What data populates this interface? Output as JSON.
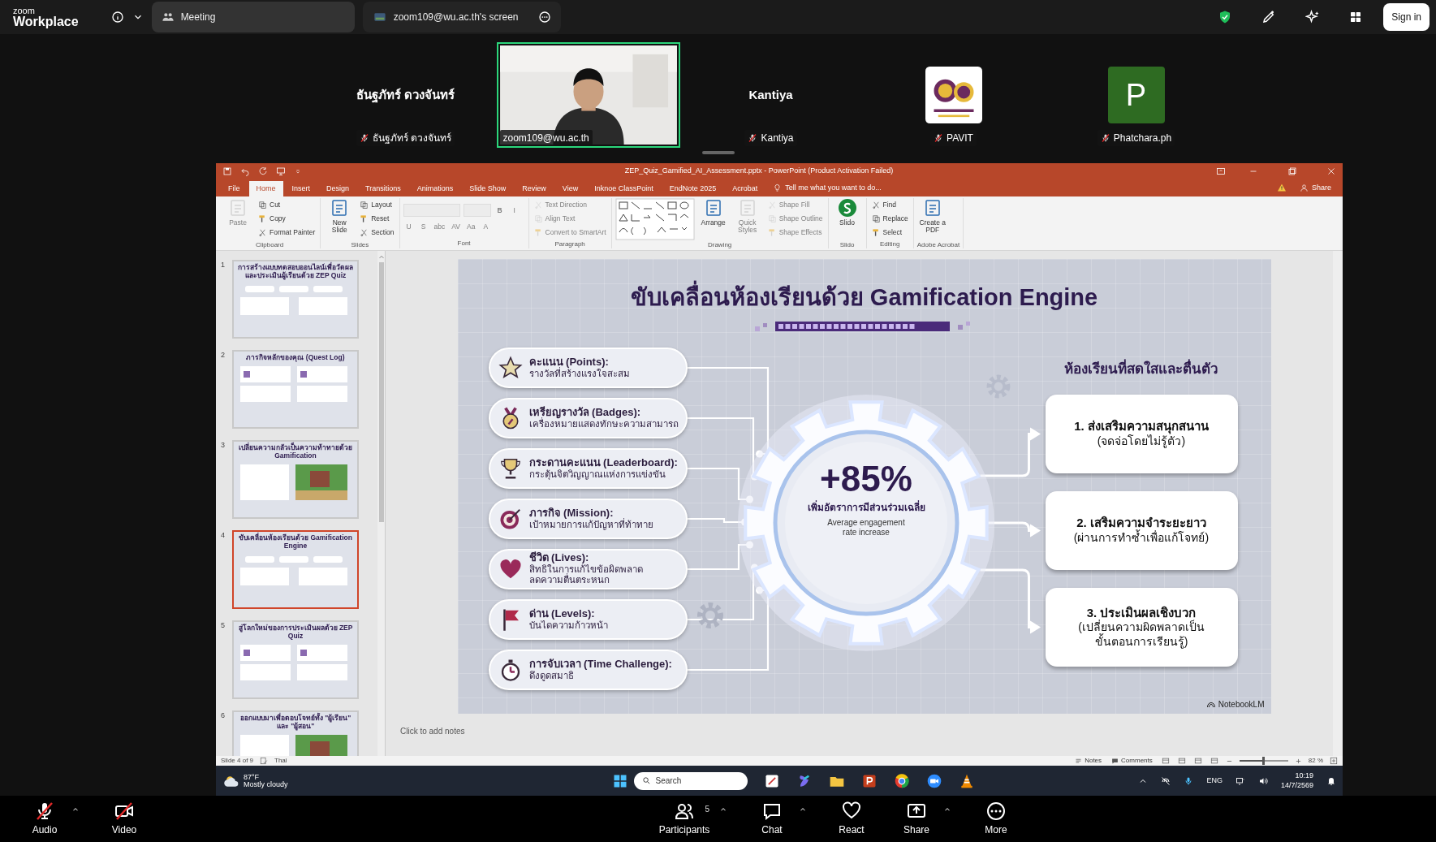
{
  "zoom_header": {
    "logo_top": "zoom",
    "logo_bottom": "Workplace",
    "tabs": [
      {
        "label": "Meeting",
        "selected": false
      },
      {
        "label": "zoom109@wu.ac.th's screen",
        "selected": true
      }
    ],
    "sign_in": "Sign in"
  },
  "participants": [
    {
      "kind": "name",
      "display_name": "ธันฐภัทร์ ดวงจันทร์",
      "label": "ธันฐภัทร์ ดวงจันทร์",
      "muted": true,
      "speaking": false
    },
    {
      "kind": "video",
      "label": "zoom109@wu.ac.th",
      "muted": false,
      "speaking": true
    },
    {
      "kind": "name",
      "display_name": "Kantiya",
      "label": "Kantiya",
      "muted": true,
      "speaking": false
    },
    {
      "kind": "logo",
      "label": "PAVIT",
      "muted": true,
      "speaking": false
    },
    {
      "kind": "initial",
      "initial": "P",
      "label": "Phatchara.ph",
      "muted": true,
      "speaking": false
    }
  ],
  "powerpoint": {
    "title": "ZEP_Quiz_Gamified_AI_Assessment.pptx - PowerPoint (Product Activation Failed)",
    "ribbon_tabs": [
      {
        "label": "File",
        "selected": false
      },
      {
        "label": "Home",
        "selected": true
      },
      {
        "label": "Insert",
        "selected": false
      },
      {
        "label": "Design",
        "selected": false
      },
      {
        "label": "Transitions",
        "selected": false
      },
      {
        "label": "Animations",
        "selected": false
      },
      {
        "label": "Slide Show",
        "selected": false
      },
      {
        "label": "Review",
        "selected": false
      },
      {
        "label": "View",
        "selected": false
      },
      {
        "label": "Inknoe ClassPoint",
        "selected": false
      },
      {
        "label": "EndNote 2025",
        "selected": false
      },
      {
        "label": "Acrobat",
        "selected": false
      }
    ],
    "tell_me": "Tell me what you want to do...",
    "share": "Share",
    "ribbon_groups": [
      {
        "label": "Clipboard",
        "items": [
          {
            "kind": "large",
            "label": "Paste",
            "disabled": true
          },
          {
            "kind": "small",
            "label": "Cut",
            "disabled": false
          },
          {
            "kind": "small",
            "label": "Copy",
            "disabled": false
          },
          {
            "kind": "small",
            "label": "Format Painter",
            "disabled": false
          }
        ]
      },
      {
        "label": "Slides",
        "items": [
          {
            "kind": "large",
            "label": "New Slide",
            "disabled": false
          },
          {
            "kind": "small",
            "label": "Layout",
            "disabled": false
          },
          {
            "kind": "small",
            "label": "Reset",
            "disabled": false
          },
          {
            "kind": "small",
            "label": "Section",
            "disabled": false
          }
        ]
      },
      {
        "label": "Font",
        "items": [
          {
            "kind": "field",
            "disabled": true
          },
          {
            "kind": "field",
            "disabled": true
          },
          {
            "kind": "glyph",
            "label": "B",
            "disabled": true
          },
          {
            "kind": "glyph",
            "label": "I",
            "disabled": true
          },
          {
            "kind": "glyph",
            "label": "U",
            "disabled": true
          },
          {
            "kind": "glyph",
            "label": "S",
            "disabled": true
          },
          {
            "kind": "glyph",
            "label": "abc",
            "disabled": true
          },
          {
            "kind": "glyph",
            "label": "AV",
            "disabled": true
          },
          {
            "kind": "glyph",
            "label": "Aa",
            "disabled": true
          },
          {
            "kind": "glyph",
            "label": "A",
            "disabled": true
          }
        ]
      },
      {
        "label": "Paragraph",
        "items": [
          {
            "kind": "small",
            "label": "Text Direction",
            "disabled": true
          },
          {
            "kind": "small",
            "label": "Align Text",
            "disabled": true
          },
          {
            "kind": "small",
            "label": "Convert to SmartArt",
            "disabled": true
          }
        ]
      },
      {
        "label": "Drawing",
        "items": [
          {
            "kind": "gallery"
          },
          {
            "kind": "large",
            "label": "Arrange",
            "disabled": false
          },
          {
            "kind": "large",
            "label": "Quick Styles",
            "disabled": true
          },
          {
            "kind": "small",
            "label": "Shape Fill",
            "disabled": true
          },
          {
            "kind": "small",
            "label": "Shape Outline",
            "disabled": true
          },
          {
            "kind": "small",
            "label": "Shape Effects",
            "disabled": true
          }
        ]
      },
      {
        "label": "Slido",
        "items": [
          {
            "kind": "large",
            "label": "Slido",
            "disabled": false
          }
        ]
      },
      {
        "label": "Editing",
        "items": [
          {
            "kind": "small",
            "label": "Find",
            "disabled": false
          },
          {
            "kind": "small",
            "label": "Replace",
            "disabled": false
          },
          {
            "kind": "small",
            "label": "Select",
            "disabled": false
          }
        ]
      },
      {
        "label": "Adobe Acrobat",
        "items": [
          {
            "kind": "large",
            "label": "Create a PDF",
            "disabled": false
          }
        ]
      }
    ],
    "thumbnails": [
      {
        "number": "1",
        "title": "การสร้างแบบทดสอบออนไลน์เพื่อวัดผลและประเมินผู้เรียนด้วย ZEP Quiz",
        "selected": false
      },
      {
        "number": "2",
        "title": "ภารกิจหลักของคุณ (Quest Log)",
        "selected": false
      },
      {
        "number": "3",
        "title": "เปลี่ยนความกลัวเป็นความท้าทายด้วย Gamification",
        "selected": false
      },
      {
        "number": "4",
        "title": "ขับเคลื่อนห้องเรียนด้วย Gamification Engine",
        "selected": true
      },
      {
        "number": "5",
        "title": "สู่โลกใหม่ของการประเมินผลด้วย ZEP Quiz",
        "selected": false
      },
      {
        "number": "6",
        "title": "ออกแบบมาเพื่อตอบโจทย์ทั้ง \"ผู้เรียน\" และ \"ผู้สอน\"",
        "selected": false
      }
    ],
    "slide": {
      "title": "ขับเคลื่อนห้องเรียนด้วย Gamification Engine",
      "features": [
        {
          "title": "คะแนน (Points):",
          "description": [
            "รางวัลที่สร้างแรงใจสะสม"
          ]
        },
        {
          "title": "เหรียญรางวัล (Badges):",
          "description": [
            "เครื่องหมายแสดงทักษะความสามารถ"
          ]
        },
        {
          "title": "กระดานคะแนน (Leaderboard):",
          "description": [
            "กระตุ้นจิตวิญญาณแห่งการแข่งขัน"
          ]
        },
        {
          "title": "ภารกิจ (Mission):",
          "description": [
            "เป้าหมายการแก้ปัญหาที่ท้าทาย"
          ]
        },
        {
          "title": "ชีวิต (Lives):",
          "description": [
            "สิทธิในการแก้ไขข้อผิดพลาด",
            "ลดความตื่นตระหนก"
          ]
        },
        {
          "title": "ด่าน (Levels):",
          "description": [
            "บันไดความก้าวหน้า"
          ]
        },
        {
          "title": "การจับเวลา (Time Challenge):",
          "description": [
            "ดึงดูดสมาธิ"
          ]
        }
      ],
      "stat": "+85%",
      "stat_label": "เพิ่มอัตราการมีส่วนร่วมเฉลี่ย",
      "stat_note": [
        "Average engagement",
        "rate increase"
      ],
      "outcomes_heading": "ห้องเรียนที่สดใสและตื่นตัว",
      "outcomes": [
        {
          "title": "1. ส่งเสริมความสนุกสนาน",
          "lines": [
            "(จดจ่อโดยไม่รู้ตัว)"
          ]
        },
        {
          "title": "2. เสริมความจำระยะยาว",
          "lines": [
            "(ผ่านการทำซ้ำเพื่อแก้โจทย์)"
          ]
        },
        {
          "title": "3. ประเมินผลเชิงบวก",
          "lines": [
            "(เปลี่ยนความผิดพลาดเป็น",
            "ขั้นตอนการเรียนรู้)"
          ]
        }
      ],
      "brand": "NotebookLM"
    },
    "notes_placeholder": "Click to add notes",
    "status_bar": {
      "slide_count": "Slide 4 of 9",
      "language": "Thai",
      "notes": "Notes",
      "comments": "Comments",
      "zoom": "82 %",
      "zoom_slider": {
        "level": 0.5
      }
    }
  },
  "taskbar": {
    "temperature": "87°F",
    "weather": "Mostly cloudy",
    "search_placeholder": "Search",
    "language": "ENG",
    "time": "10:19",
    "date": "14/7/2569"
  },
  "zoom_toolbar": [
    {
      "kind": "audio",
      "label": "Audio",
      "off": true
    },
    {
      "kind": "video",
      "label": "Video",
      "off": true
    },
    {
      "kind": "participants",
      "label": "Participants",
      "count": "5"
    },
    {
      "kind": "chat",
      "label": "Chat"
    },
    {
      "kind": "react",
      "label": "React"
    },
    {
      "kind": "share",
      "label": "Share"
    },
    {
      "kind": "more",
      "label": "More"
    }
  ]
}
